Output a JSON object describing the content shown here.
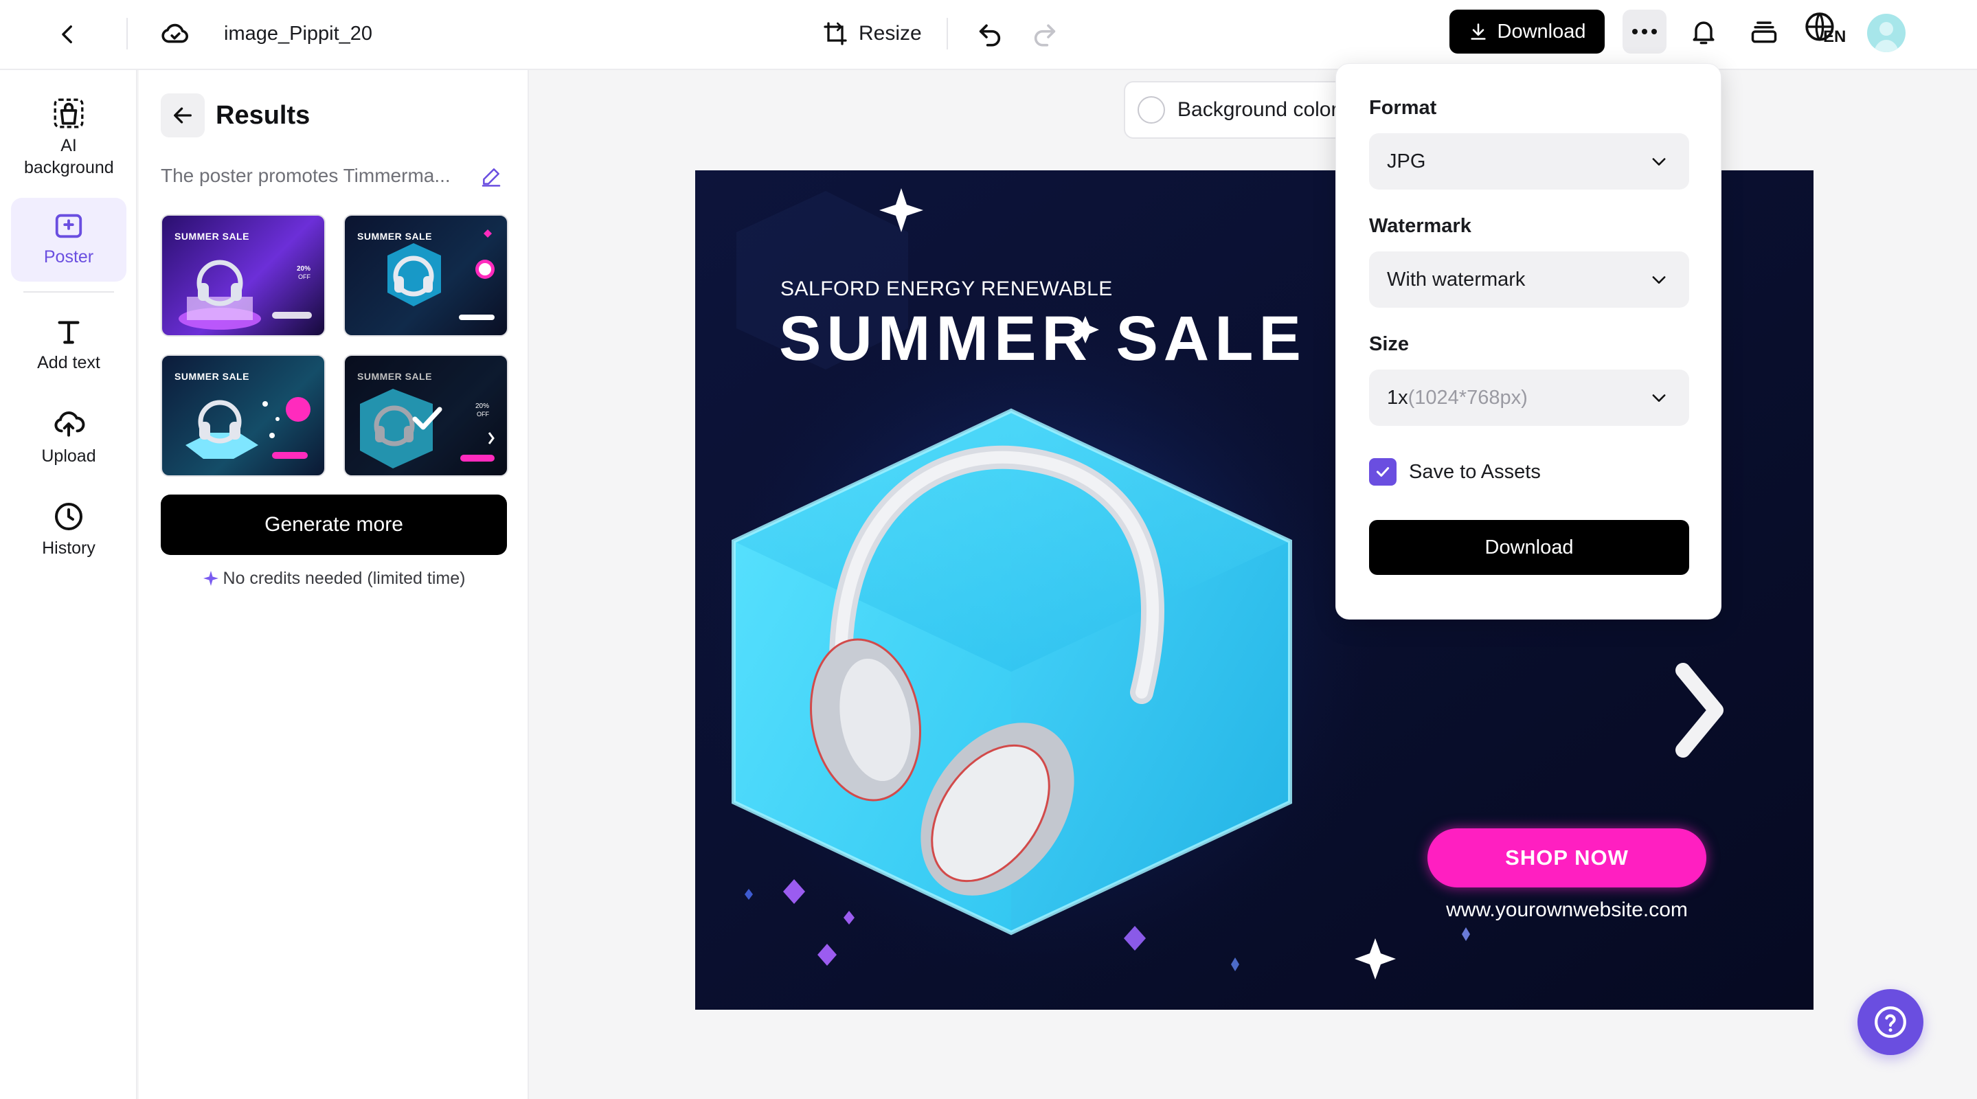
{
  "topbar": {
    "filename": "image_Pippit_20",
    "resize_label": "Resize",
    "download_label": "Download",
    "language_code": "EN",
    "icons": [
      "chevron-left-icon",
      "cloud-icon",
      "resize-icon",
      "undo-icon",
      "redo-icon",
      "download-icon",
      "more-icon",
      "bell-icon",
      "layers-icon",
      "globe-icon",
      "avatar"
    ]
  },
  "rail": {
    "items": [
      {
        "label": "AI background",
        "icon": "bag-icon",
        "active": false
      },
      {
        "label": "Poster",
        "icon": "poster-icon",
        "active": true
      },
      {
        "label": "Add text",
        "icon": "text-icon",
        "active": false
      },
      {
        "label": "Upload",
        "icon": "upload-icon",
        "active": false
      },
      {
        "label": "History",
        "icon": "clock-icon",
        "active": false
      }
    ]
  },
  "panel": {
    "title": "Results",
    "prompt": "The poster promotes Timmerma...",
    "thumbnails": [
      {
        "title": "SUMMER SALE",
        "selected": false
      },
      {
        "title": "SUMMER SALE",
        "selected": false
      },
      {
        "title": "SUMMER SALE",
        "selected": false
      },
      {
        "title": "SUMMER SALE",
        "selected": true
      }
    ],
    "generate_label": "Generate more",
    "credits_note": "No credits needed (limited time)"
  },
  "canvas": {
    "background_color_label": "Background color",
    "poster": {
      "subtitle": "SALFORD ENERGY RENEWABLE",
      "title": "SUMMER SALE",
      "shop_button": "SHOP NOW",
      "website": "www.yourownwebsite.com"
    }
  },
  "download_menu": {
    "format_label": "Format",
    "format_value": "JPG",
    "watermark_label": "Watermark",
    "watermark_value": "With watermark",
    "size_label": "Size",
    "size_value_main": "1x",
    "size_value_detail": "(1024*768px)",
    "save_to_assets_label": "Save to Assets",
    "save_to_assets_checked": true,
    "download_button": "Download"
  },
  "colors": {
    "accent": "#6a4ee0",
    "poster_bg": "#0b0f2f",
    "shop_now": "#ff1fc1",
    "cube": "#3fd0f5"
  }
}
